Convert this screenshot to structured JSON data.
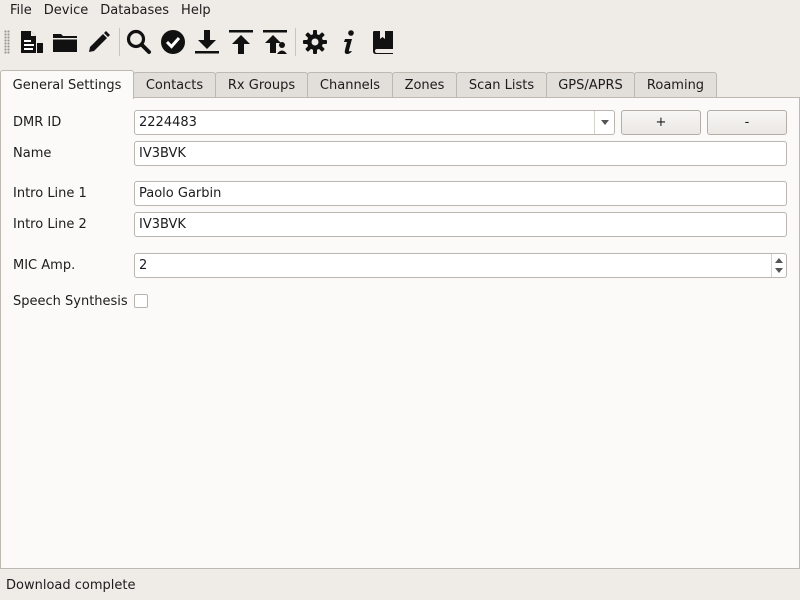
{
  "menubar": {
    "items": [
      "File",
      "Device",
      "Databases",
      "Help"
    ]
  },
  "toolbar": {
    "buttons": [
      {
        "icon": "new-codeplug-icon"
      },
      {
        "icon": "open-folder-icon"
      },
      {
        "icon": "edit-pencil-icon"
      },
      {
        "icon": "search-icon"
      },
      {
        "icon": "verify-check-icon"
      },
      {
        "icon": "download-icon"
      },
      {
        "icon": "upload-icon"
      },
      {
        "icon": "upload-callsign-db-icon"
      },
      {
        "icon": "settings-gear-icon"
      },
      {
        "icon": "info-icon"
      },
      {
        "icon": "manual-book-icon"
      }
    ]
  },
  "tabs": [
    "General Settings",
    "Contacts",
    "Rx Groups",
    "Channels",
    "Zones",
    "Scan Lists",
    "GPS/APRS",
    "Roaming"
  ],
  "active_tab": "General Settings",
  "general": {
    "dmr_id_label": "DMR ID",
    "dmr_id_value": "2224483",
    "add_label": "+",
    "remove_label": "-",
    "name_label": "Name",
    "name_value": "IV3BVK",
    "intro1_label": "Intro Line 1",
    "intro1_value": "Paolo Garbin",
    "intro2_label": "Intro Line 2",
    "intro2_value": "IV3BVK",
    "mic_label": "MIC Amp.",
    "mic_value": "2",
    "speech_label": "Speech Synthesis",
    "speech_checked": false
  },
  "status": {
    "text": "Download complete"
  }
}
